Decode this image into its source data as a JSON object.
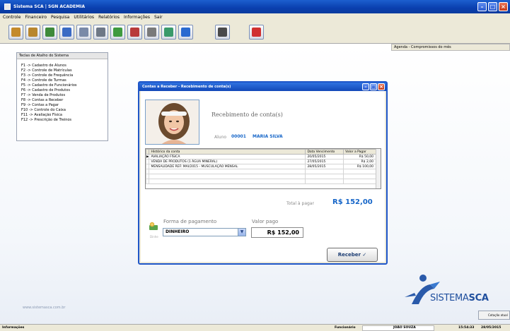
{
  "window": {
    "title": "Sistema SCA | SGN ACADEMIA"
  },
  "menu": [
    "Controle",
    "Financeiro",
    "Pesquisa",
    "Utilitários",
    "Relatórios",
    "Informações",
    "Sair"
  ],
  "toolbar": {
    "buttons": [
      {
        "icon": "students-icon",
        "color": "#c48a2c"
      },
      {
        "icon": "enrollment-icon",
        "color": "#b8862e"
      },
      {
        "icon": "frequency-icon",
        "color": "#3e8a3a"
      },
      {
        "icon": "user-icon",
        "color": "#3a6ac4"
      },
      {
        "icon": "cart-icon",
        "color": "#7a8aa8"
      },
      {
        "icon": "printer-icon",
        "color": "#6e7886"
      },
      {
        "icon": "money-in-icon",
        "color": "#3f9a3f"
      },
      {
        "icon": "money-out-icon",
        "color": "#b83a3a"
      },
      {
        "icon": "tools-icon",
        "color": "#7a7a7a"
      },
      {
        "icon": "reports-icon",
        "color": "#3a9a6a"
      },
      {
        "icon": "help-icon",
        "color": "#2a6ad0"
      },
      {
        "icon": "logoff-icon",
        "color": "#4a4a4a"
      },
      {
        "icon": "power-icon",
        "color": "#d03030"
      }
    ]
  },
  "agenda": {
    "header": "Agenda - Compromissos do mês"
  },
  "shortcuts": {
    "header": "Teclas de Atalho do Sistema",
    "items": [
      "F1 -> Cadastro de Alunos",
      "F2 -> Controle de Matrículas",
      "F3 -> Controle de Frequência",
      "F4 -> Controle de Turmas",
      "F5 -> Cadastro de Funcionários",
      "F6 -> Cadastro de Produtos",
      "F7 -> Venda de Produtos",
      "F8 -> Contas a Receber",
      "F9 -> Contas a Pagar",
      "F10 -> Controle do Caixa",
      "F11 -> Avaliação Física",
      "F12 -> Prescrição de Treinos"
    ]
  },
  "dialog": {
    "title": "Contas a Receber - Recebimento de conta(s)",
    "heading": "Recebimento de conta(s)",
    "aluno_label": "Aluno",
    "aluno_code": "00001",
    "aluno_name": "MARIA SILVA",
    "grid": {
      "columns": [
        "Histórico da conta",
        "Data Vencimento",
        "Valor a Pagar"
      ],
      "rows": [
        {
          "historico": "AVALIAÇÃO FÍSICA",
          "vencimento": "20/05/2015",
          "valor": "R$ 50,00",
          "current": true
        },
        {
          "historico": "VENDA DE PRODUTOS (1 ÁGUA MINERAL)",
          "vencimento": "27/05/2015",
          "valor": "R$ 2,00",
          "current": false
        },
        {
          "historico": "MENSALIDADE REF: MAI/2015 - MUSCULAÇÃO MENSAL",
          "vencimento": "28/05/2015",
          "valor": "R$ 100,00",
          "current": false
        }
      ]
    },
    "total_label": "Total à pagar",
    "total_value": "R$ 152,00",
    "forma_label": "Forma de pagamento",
    "forma_value": "DINHEIRO",
    "valor_label": "Valor pago",
    "valor_value": "R$ 152,00",
    "pay_hint": "Dinhe",
    "receive_button": "Receber ✓"
  },
  "branding": {
    "website": "www.sistemasca.com.br",
    "logo_text_1": "SISTEMA",
    "logo_text_2": "SCA",
    "small_button": "Cotação atual"
  },
  "statusbar": {
    "left": "Informações",
    "func_label": "Funcionário",
    "func_value": "JOÃO SOUZA",
    "time": "15:54:33",
    "date": "28/05/2015"
  }
}
